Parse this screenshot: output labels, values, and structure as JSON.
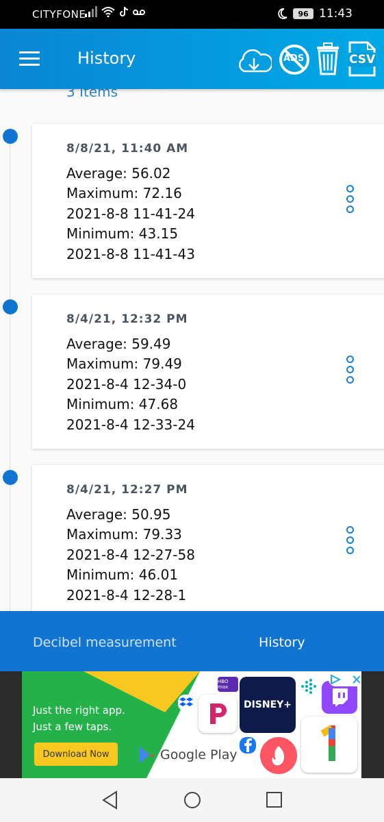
{
  "status": {
    "carrier": "CITYFONE",
    "battery": "96",
    "time": "11:43"
  },
  "appbar": {
    "title": "History",
    "ads_label": "ADS",
    "csv_label": "CSV"
  },
  "history": {
    "count_label": "3 Items",
    "entries": [
      {
        "date": "8/8/21, 11:40 AM",
        "lines": [
          "Average: 56.02",
          "Maximum: 72.16",
          "2021-8-8 11-41-24",
          "Minimum: 43.15",
          "2021-8-8 11-41-43"
        ]
      },
      {
        "date": "8/4/21, 12:32 PM",
        "lines": [
          "Average: 59.49",
          "Maximum: 79.49",
          "2021-8-4 12-34-0",
          "Minimum: 47.68",
          "2021-8-4 12-33-24"
        ]
      },
      {
        "date": "8/4/21, 12:27 PM",
        "lines": [
          "Average: 50.95",
          "Maximum: 79.33",
          "2021-8-4 12-27-58",
          "Minimum: 46.01",
          "2021-8-4 12-28-1"
        ]
      }
    ]
  },
  "bottom_nav": {
    "tab1": "Decibel measurement",
    "tab2": "History"
  },
  "ad": {
    "line1": "Just the right app.",
    "line2": "Just a few taps.",
    "button": "Download Now",
    "store": "Google Play",
    "hbo": "HBO max",
    "disney": "DISNEY+"
  },
  "colors": {
    "primary": "#1274d1",
    "appbar_start": "#0a86d4",
    "appbar_end": "#00a9e6"
  }
}
